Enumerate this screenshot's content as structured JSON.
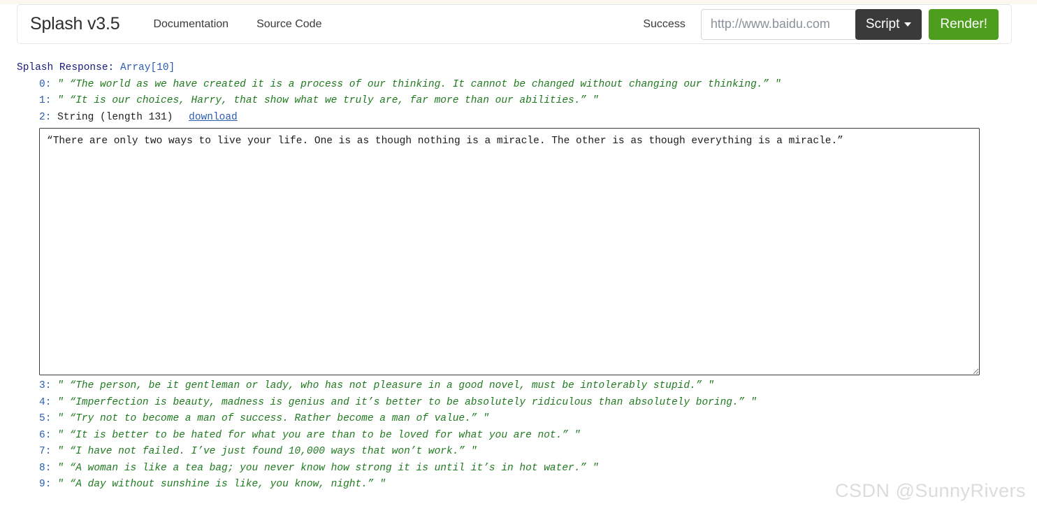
{
  "top_strip_color": "#fdf8ef",
  "navbar": {
    "brand": "Splash v3.5",
    "links": [
      {
        "label": "Documentation"
      },
      {
        "label": "Source Code"
      }
    ],
    "status": "Success",
    "url_input": {
      "value": "http://www.baidu.com",
      "placeholder": "http://www.baidu.com"
    },
    "script_button": {
      "label": "Script",
      "caret_icon": "chevron-down-icon",
      "color": "#3a3a3a"
    },
    "render_button": {
      "label": "Render!",
      "color": "#4c9e1c"
    }
  },
  "response": {
    "header_label": "Splash Response: ",
    "header_type": "Array",
    "header_suffix": "[10]",
    "entries": [
      {
        "index": "0:",
        "kind": "quote",
        "open_mark": "″",
        "text": "“The world as we have created it is a process of our thinking. It cannot be changed without changing our thinking.”",
        "close_mark": "″"
      },
      {
        "index": "1:",
        "kind": "quote",
        "open_mark": "″",
        "text": "“It is our choices, Harry, that show what we truly are, far more than our abilities.”",
        "close_mark": "″"
      },
      {
        "index": "2:",
        "kind": "string-blob",
        "type_label": "String (length 131)",
        "download_label": "download",
        "blob_value": "“There are only two ways to live your life. One is as though nothing is a miracle. The other is as though everything is a miracle.”"
      },
      {
        "index": "3:",
        "kind": "quote",
        "open_mark": "″",
        "text": "“The person, be it gentleman or lady, who has not pleasure in a good novel, must be intolerably stupid.”",
        "close_mark": "″"
      },
      {
        "index": "4:",
        "kind": "quote",
        "open_mark": "″",
        "text": "“Imperfection is beauty, madness is genius and it’s better to be absolutely ridiculous than absolutely boring.”",
        "close_mark": "″"
      },
      {
        "index": "5:",
        "kind": "quote",
        "open_mark": "″",
        "text": "“Try not to become a man of success. Rather become a man of value.”",
        "close_mark": "″"
      },
      {
        "index": "6:",
        "kind": "quote",
        "open_mark": "″",
        "text": "“It is better to be hated for what you are than to be loved for what you are not.”",
        "close_mark": "″"
      },
      {
        "index": "7:",
        "kind": "quote",
        "open_mark": "″",
        "text": "“I have not failed. I’ve just found 10,000 ways that won’t work.”",
        "close_mark": "″"
      },
      {
        "index": "8:",
        "kind": "quote",
        "open_mark": "″",
        "text": "“A woman is like a tea bag; you never know how strong it is until it’s in hot water.”",
        "close_mark": "″"
      },
      {
        "index": "9:",
        "kind": "quote",
        "open_mark": "″",
        "text": "“A day without sunshine is like, you know, night.”",
        "close_mark": "″"
      }
    ]
  },
  "watermark": "CSDN @SunnyRivers"
}
